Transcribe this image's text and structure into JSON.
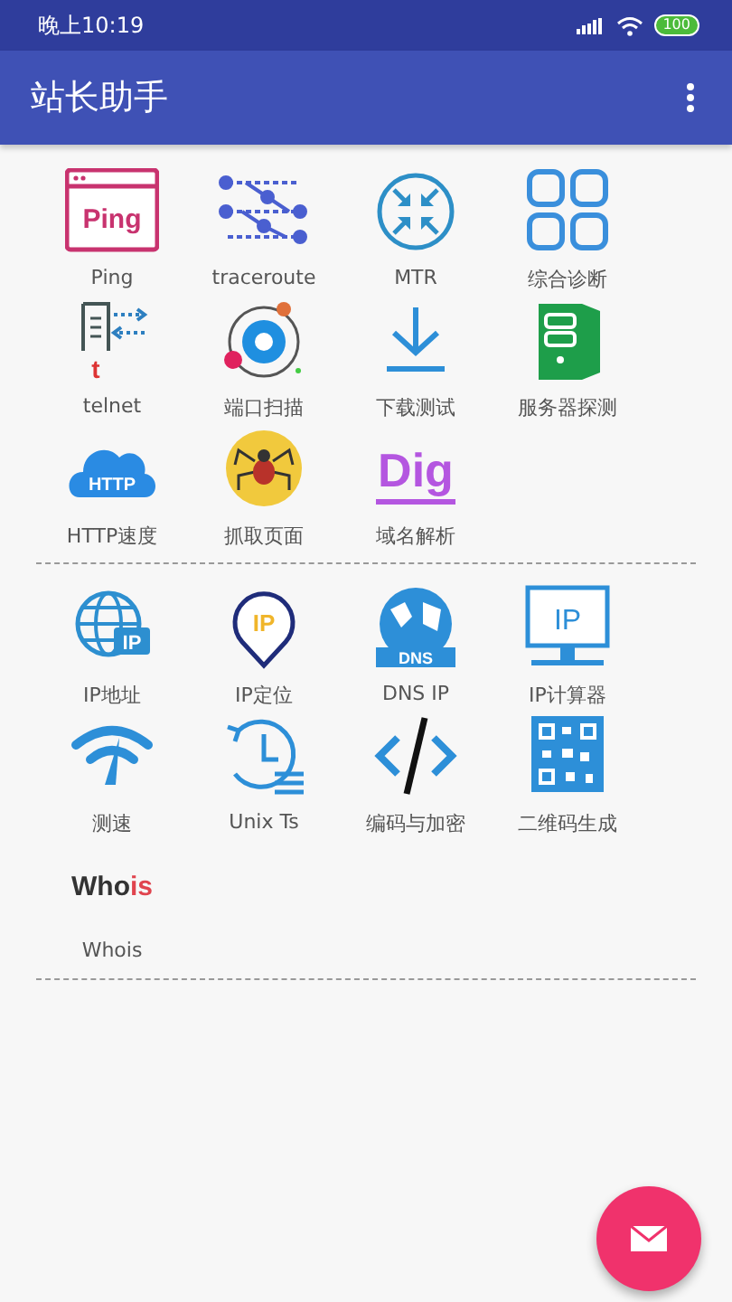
{
  "status_bar": {
    "time": "晚上10:19",
    "battery": "100"
  },
  "toolbar": {
    "title": "站长助手"
  },
  "sections": [
    {
      "items": [
        {
          "kind": "ping",
          "label": "Ping",
          "icon_text": "Ping"
        },
        {
          "kind": "trace",
          "label": "traceroute"
        },
        {
          "kind": "mtr",
          "label": "MTR"
        },
        {
          "kind": "grid",
          "label": "综合诊断"
        },
        {
          "kind": "telnet",
          "label": "telnet",
          "icon_text": "t"
        },
        {
          "kind": "scan",
          "label": "端口扫描"
        },
        {
          "kind": "download",
          "label": "下载测试"
        },
        {
          "kind": "server",
          "label": "服务器探测"
        },
        {
          "kind": "http",
          "label": "HTTP速度",
          "icon_text": "HTTP"
        },
        {
          "kind": "spider",
          "label": "抓取页面"
        },
        {
          "kind": "dig",
          "label": "域名解析",
          "icon_text": "Dig"
        }
      ]
    },
    {
      "items": [
        {
          "kind": "globe",
          "label": "IP地址",
          "icon_text": "IP"
        },
        {
          "kind": "pin",
          "label": "IP定位",
          "icon_text": "IP"
        },
        {
          "kind": "dns",
          "label": "DNS IP",
          "icon_text": "DNS"
        },
        {
          "kind": "monitor",
          "label": "IP计算器",
          "icon_text": "IP"
        },
        {
          "kind": "wifi",
          "label": "测速"
        },
        {
          "kind": "clock",
          "label": "Unix Ts"
        },
        {
          "kind": "code",
          "label": "编码与加密"
        },
        {
          "kind": "qr",
          "label": "二维码生成"
        },
        {
          "kind": "whois",
          "label": "Whois",
          "icon_text": "Who",
          "icon_text_accent": "is"
        }
      ]
    }
  ]
}
